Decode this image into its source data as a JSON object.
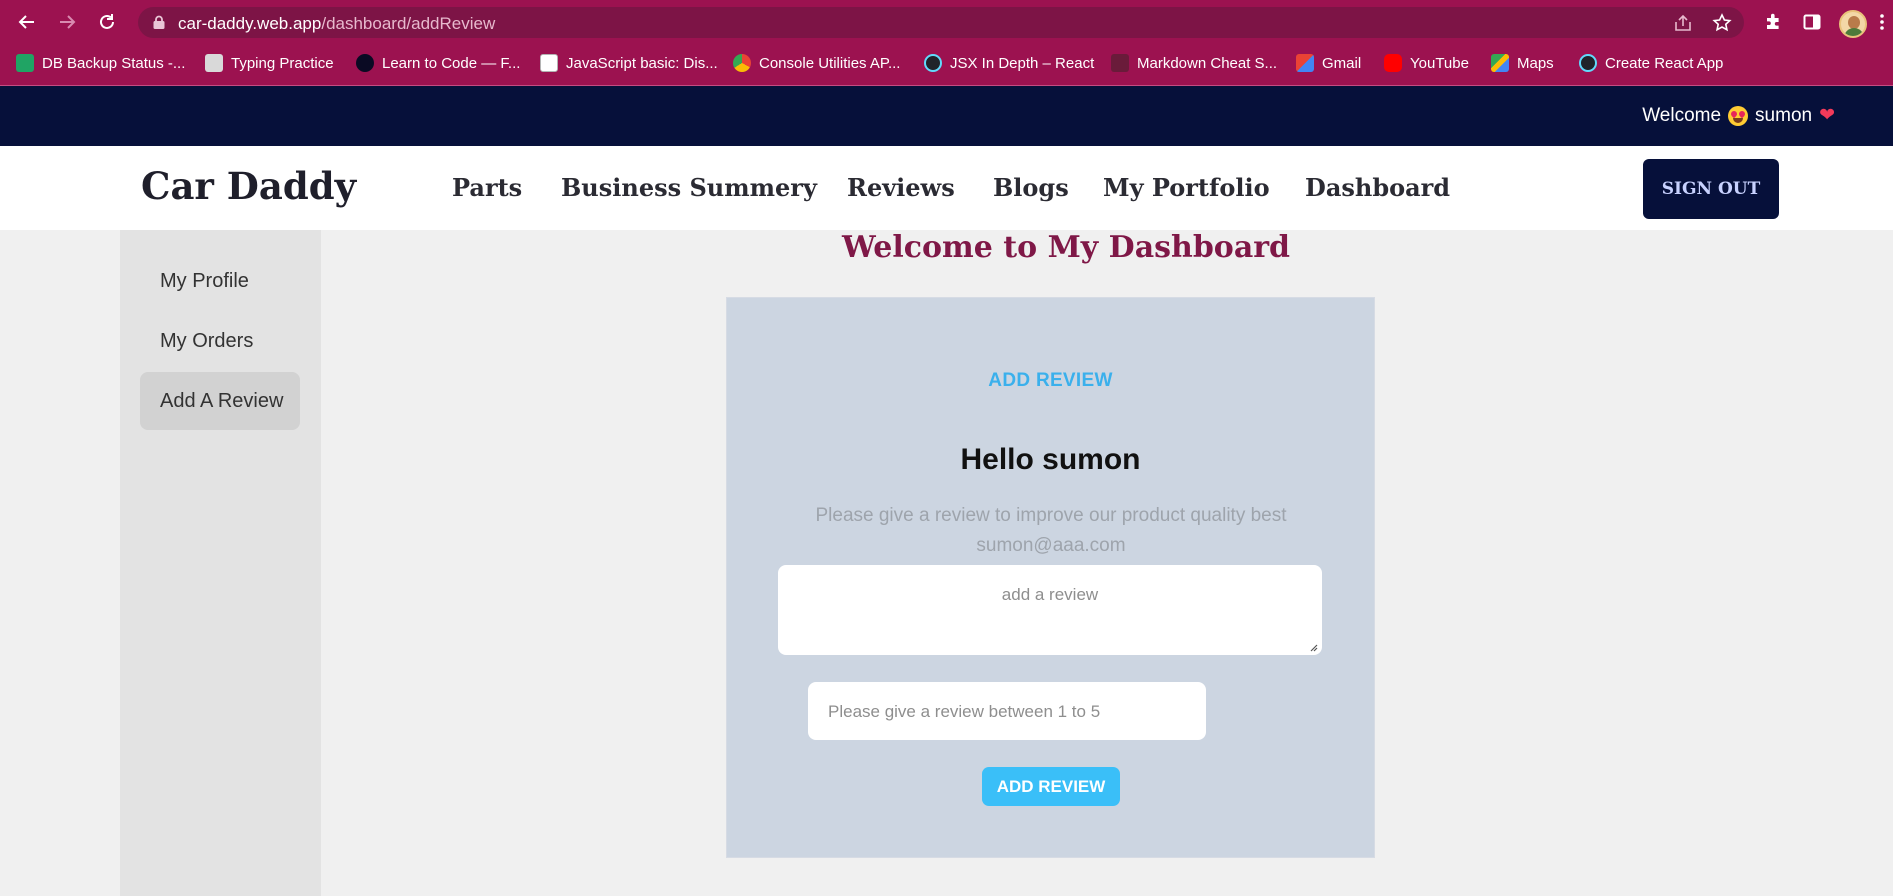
{
  "browser": {
    "url_host": "car-daddy.web.app",
    "url_path": "/dashboard/addReview",
    "bookmarks": [
      {
        "label": "DB Backup Status -...",
        "icon": "google-sheets-icon"
      },
      {
        "label": "Typing Practice",
        "icon": "typing-icon"
      },
      {
        "label": "Learn to Code — F...",
        "icon": "freecodecamp-icon"
      },
      {
        "label": "JavaScript basic: Dis...",
        "icon": "w3resource-icon"
      },
      {
        "label": "Console Utilities AP...",
        "icon": "chrome-icon"
      },
      {
        "label": "JSX In Depth – React",
        "icon": "react-icon"
      },
      {
        "label": "Markdown Cheat S...",
        "icon": "markdown-icon"
      },
      {
        "label": "Gmail",
        "icon": "gmail-icon"
      },
      {
        "label": "YouTube",
        "icon": "youtube-icon"
      },
      {
        "label": "Maps",
        "icon": "maps-icon"
      },
      {
        "label": "Create React App",
        "icon": "react-icon"
      }
    ]
  },
  "topbar": {
    "welcome_text": "Welcome",
    "user_name": "sumon",
    "heart": "❤"
  },
  "navbar": {
    "brand": "Car Daddy",
    "links": [
      "Parts",
      "Business Summery",
      "Reviews",
      "Blogs",
      "My Portfolio",
      "Dashboard"
    ],
    "signout_label": "SIGN OUT"
  },
  "sidebar": {
    "items": [
      "My Profile",
      "My Orders",
      "Add A Review"
    ],
    "active_index": 2
  },
  "dashboard": {
    "title": "Welcome to My Dashboard"
  },
  "review_form": {
    "heading": "ADD REVIEW",
    "greeting": "Hello sumon",
    "hint_line1": "Please give a review to improve our product quality best",
    "hint_line2": "sumon@aaa.com",
    "review_placeholder": "add a review",
    "rating_placeholder": "Please give a review between 1 to 5",
    "submit_label": "ADD REVIEW"
  },
  "colors": {
    "browser_chrome": "#9c1250",
    "topbar": "#06103a",
    "dashboard_title": "#7f1847",
    "accent": "#3abff8",
    "card_bg": "#ccd5e1"
  }
}
